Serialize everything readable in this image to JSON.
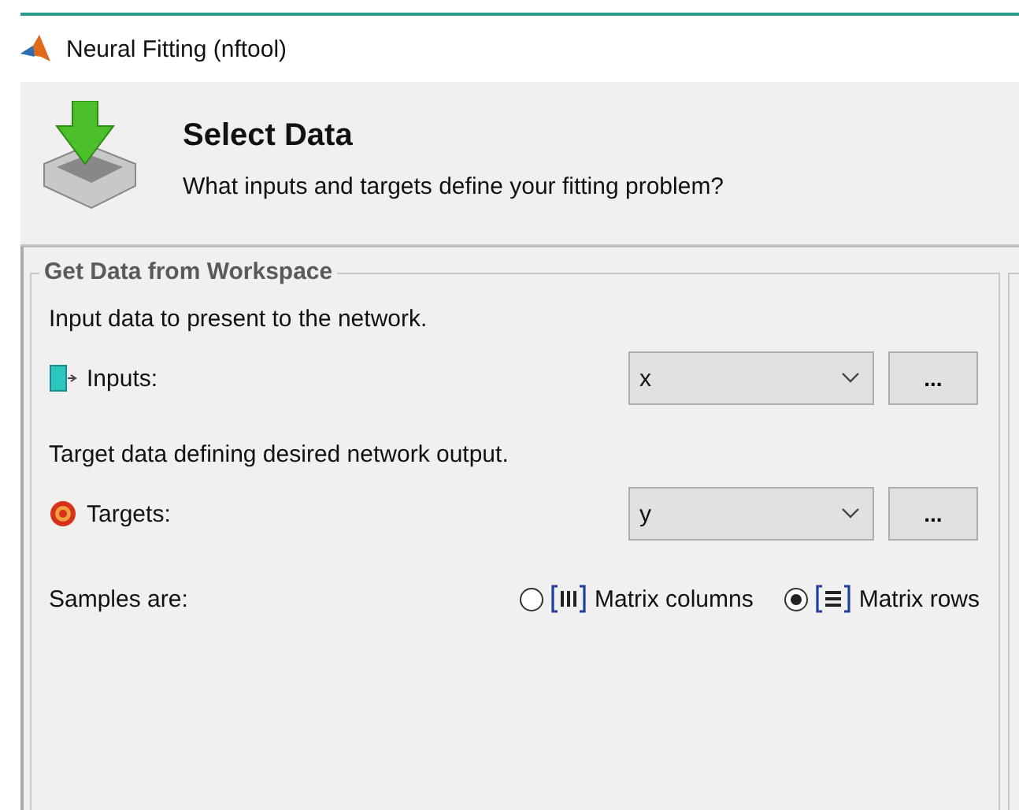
{
  "window": {
    "title": "Neural Fitting (nftool)"
  },
  "header": {
    "title": "Select Data",
    "subtitle": "What inputs and targets define your fitting problem?"
  },
  "group": {
    "title": "Get Data from Workspace",
    "fields": [
      {
        "kind": "inputs",
        "description": "Input data to present to the network.",
        "label": "Inputs:",
        "value": "x",
        "browse": "..."
      },
      {
        "kind": "targets",
        "description": "Target data defining desired network output.",
        "label": "Targets:",
        "value": "y",
        "browse": "..."
      }
    ],
    "samples": {
      "label": "Samples are:",
      "options": [
        {
          "kind": "columns",
          "label": "Matrix columns",
          "selected": false
        },
        {
          "kind": "rows",
          "label": "Matrix rows",
          "selected": true
        }
      ]
    }
  }
}
